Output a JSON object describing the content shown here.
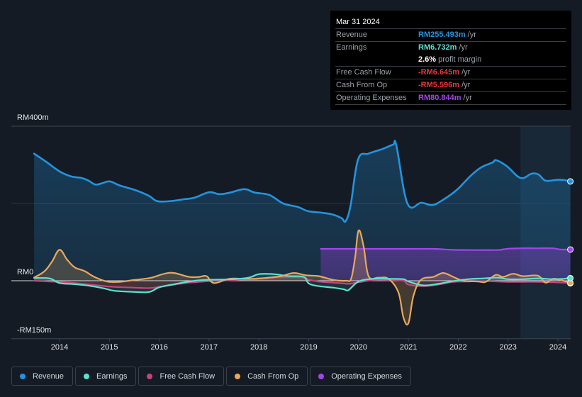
{
  "tooltip": {
    "date": "Mar 31 2024",
    "rows": [
      {
        "label": "Revenue",
        "value": "RM255.493m",
        "unit": "/yr",
        "color": "#2394df"
      },
      {
        "label": "Earnings",
        "value": "RM6.732m",
        "unit": "/yr",
        "color": "#5ce1d0"
      },
      {
        "label": "",
        "value": "2.6%",
        "unit": "profit margin",
        "color": "#ffffff"
      },
      {
        "label": "Free Cash Flow",
        "value": "-RM6.645m",
        "unit": "/yr",
        "color": "#e5383b"
      },
      {
        "label": "Cash From Op",
        "value": "-RM5.596m",
        "unit": "/yr",
        "color": "#e5383b"
      },
      {
        "label": "Operating Expenses",
        "value": "RM80.844m",
        "unit": "/yr",
        "color": "#a444ec"
      }
    ]
  },
  "legend": [
    {
      "label": "Revenue",
      "color": "#2394df"
    },
    {
      "label": "Earnings",
      "color": "#5ce1d0"
    },
    {
      "label": "Free Cash Flow",
      "color": "#c2457f"
    },
    {
      "label": "Cash From Op",
      "color": "#e9a85a"
    },
    {
      "label": "Operating Expenses",
      "color": "#a444ec"
    }
  ],
  "chart_data": {
    "type": "area",
    "title": "",
    "xlabel": "",
    "ylabel": "",
    "ylim": [
      -150,
      400
    ],
    "xlim": [
      2013.0,
      2024.25
    ],
    "y_tick_labels": [
      "RM400m",
      "RM0",
      "-RM150m"
    ],
    "y_ticks": [
      400,
      0,
      -150
    ],
    "x_tick_labels": [
      "2014",
      "2015",
      "2016",
      "2017",
      "2018",
      "2019",
      "2020",
      "2021",
      "2022",
      "2023",
      "2024"
    ],
    "x_ticks": [
      2014,
      2015,
      2016,
      2017,
      2018,
      2019,
      2020,
      2021,
      2022,
      2023,
      2024
    ],
    "gridlines": [
      400,
      200
    ],
    "forecast_shade_start": 2023.25,
    "units": "RM m",
    "series": [
      {
        "name": "Revenue",
        "color": "#2394df",
        "x": [
          2013.49,
          2013.73,
          2014.0,
          2014.23,
          2014.44,
          2014.58,
          2014.72,
          2014.87,
          2015.01,
          2015.22,
          2015.51,
          2015.79,
          2015.96,
          2016.22,
          2016.5,
          2016.71,
          2017.0,
          2017.21,
          2017.42,
          2017.71,
          2017.92,
          2018.21,
          2018.49,
          2018.78,
          2018.99,
          2019.27,
          2019.49,
          2019.66,
          2019.74,
          2019.84,
          2019.99,
          2020.2,
          2020.48,
          2020.69,
          2020.76,
          2020.98,
          2021.26,
          2021.48,
          2021.69,
          2021.97,
          2022.26,
          2022.47,
          2022.69,
          2022.76,
          2022.97,
          2023.25,
          2023.47,
          2023.61,
          2023.75,
          2023.96,
          2024.1,
          2024.25
        ],
        "values": [
          329,
          308,
          283,
          270,
          266,
          259,
          249,
          253,
          257,
          246,
          235,
          220,
          206,
          206,
          211,
          215,
          229,
          224,
          228,
          237,
          228,
          222,
          200,
          191,
          180,
          176,
          171,
          162,
          154,
          195,
          314,
          329,
          341,
          352,
          349,
          200,
          202,
          196,
          209,
          235,
          273,
          294,
          306,
          312,
          297,
          266,
          277,
          275,
          259,
          261,
          261,
          257
        ]
      },
      {
        "name": "Earnings",
        "color": "#5ce1d0",
        "x": [
          2013.49,
          2013.8,
          2014.0,
          2014.3,
          2014.6,
          2014.9,
          2015.1,
          2015.5,
          2015.8,
          2016.0,
          2016.3,
          2016.6,
          2016.9,
          2017.2,
          2017.5,
          2017.8,
          2018.0,
          2018.3,
          2018.6,
          2018.9,
          2019.0,
          2019.2,
          2019.5,
          2019.7,
          2019.8,
          2020.0,
          2020.3,
          2020.6,
          2020.9,
          2021.0,
          2021.3,
          2021.6,
          2021.9,
          2022.2,
          2022.5,
          2022.8,
          2023.0,
          2023.3,
          2023.6,
          2023.9,
          2024.1,
          2024.25
        ],
        "values": [
          7,
          6,
          -6,
          -9,
          -13,
          -20,
          -26,
          -29,
          -29,
          -17,
          -9,
          -2,
          2,
          3,
          4,
          8,
          17,
          17,
          12,
          10,
          -7,
          -14,
          -18,
          -22,
          -24,
          -2,
          5,
          5,
          4,
          -2,
          -12,
          -8,
          -1,
          4,
          6,
          8,
          4,
          4,
          6,
          4,
          5,
          6.7
        ]
      },
      {
        "name": "Free Cash Flow",
        "color": "#c2457f",
        "x": [
          2013.49,
          2013.8,
          2014.0,
          2014.3,
          2014.6,
          2014.9,
          2015.1,
          2015.5,
          2015.8,
          2016.0,
          2016.3,
          2016.6,
          2016.9,
          2017.2,
          2017.5,
          2017.8,
          2018.0,
          2018.3,
          2018.6,
          2018.9,
          2019.0,
          2019.2,
          2019.5,
          2019.7,
          2019.8,
          2020.0,
          2020.3,
          2020.6,
          2020.9,
          2021.0,
          2021.3,
          2021.6,
          2021.9,
          2022.2,
          2022.5,
          2022.8,
          2023.0,
          2023.3,
          2023.6,
          2023.9,
          2024.1,
          2024.25
        ],
        "values": [
          0,
          -2,
          -3,
          -6,
          -10,
          -14,
          -16,
          -18,
          -19,
          -16,
          -10,
          -5,
          -2,
          0,
          2,
          4,
          6,
          8,
          10,
          8,
          3,
          -2,
          -5,
          -7,
          -8,
          -4,
          2,
          2,
          0,
          -10,
          -14,
          -10,
          -3,
          -2,
          -1,
          -2,
          -3,
          -3,
          -3,
          -4,
          -5,
          -6.6
        ]
      },
      {
        "name": "Cash From Op",
        "color": "#e9a85a",
        "x": [
          2013.49,
          2013.7,
          2013.85,
          2014.0,
          2014.15,
          2014.3,
          2014.5,
          2014.7,
          2014.95,
          2015.2,
          2015.5,
          2015.7,
          2015.85,
          2016.1,
          2016.3,
          2016.6,
          2016.8,
          2016.95,
          2017.1,
          2017.4,
          2017.7,
          2017.95,
          2018.2,
          2018.45,
          2018.7,
          2018.95,
          2019.2,
          2019.5,
          2019.75,
          2019.85,
          2019.93,
          2020.0,
          2020.1,
          2020.2,
          2020.4,
          2020.6,
          2020.8,
          2020.9,
          2021.0,
          2021.1,
          2021.25,
          2021.5,
          2021.7,
          2021.9,
          2022.1,
          2022.4,
          2022.55,
          2022.75,
          2022.9,
          2023.1,
          2023.3,
          2023.6,
          2023.75,
          2023.9,
          2024.05,
          2024.25
        ],
        "values": [
          8,
          25,
          50,
          80,
          55,
          35,
          25,
          10,
          -2,
          -3,
          2,
          5,
          8,
          18,
          20,
          10,
          10,
          12,
          -6,
          5,
          5,
          5,
          8,
          12,
          20,
          14,
          12,
          2,
          0,
          5,
          60,
          130,
          90,
          12,
          8,
          5,
          -30,
          -95,
          -110,
          -40,
          2,
          10,
          20,
          10,
          0,
          -2,
          -3,
          15,
          10,
          18,
          12,
          13,
          -5,
          5,
          2,
          -5.6
        ]
      },
      {
        "name": "Operating Expenses",
        "color": "#a444ec",
        "x": [
          2019.24,
          2019.5,
          2020.0,
          2020.5,
          2021.0,
          2021.5,
          2021.9,
          2022.2,
          2022.5,
          2022.8,
          2023.0,
          2023.3,
          2023.6,
          2023.9,
          2024.05,
          2024.25
        ],
        "values": [
          82.5,
          82.5,
          82.5,
          82.5,
          82.5,
          82.5,
          80,
          79.5,
          79.5,
          79.5,
          83,
          84,
          84,
          84,
          81,
          80.8
        ]
      }
    ]
  }
}
